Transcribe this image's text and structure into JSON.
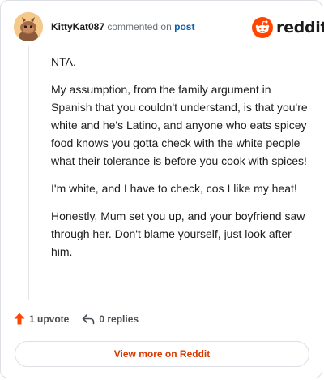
{
  "header": {
    "username": "KittyKat087",
    "commented_text": "commented on",
    "post_link": "post",
    "logo_text": "reddit",
    "avatar_icon": "snoo-avatar-icon"
  },
  "comment": {
    "paragraphs": [
      "NTA.",
      "My assumption, from the family argument in Spanish that you couldn't understand, is that you're white and he's Latino, and anyone who eats spicey food knows you gotta check with the white people what their tolerance is before you cook with spices!",
      "I'm white, and I have to check, cos I like my heat!",
      "Honestly, Mum set you up, and your boyfriend saw through her. Don't blame yourself, just look after him."
    ]
  },
  "actions": {
    "upvote_label": "1 upvote",
    "replies_label": "0 replies"
  },
  "footer": {
    "view_more_label": "View more on Reddit"
  },
  "colors": {
    "brand": "#ff4500",
    "link": "#0f5eae",
    "view_more": "#d93900"
  }
}
